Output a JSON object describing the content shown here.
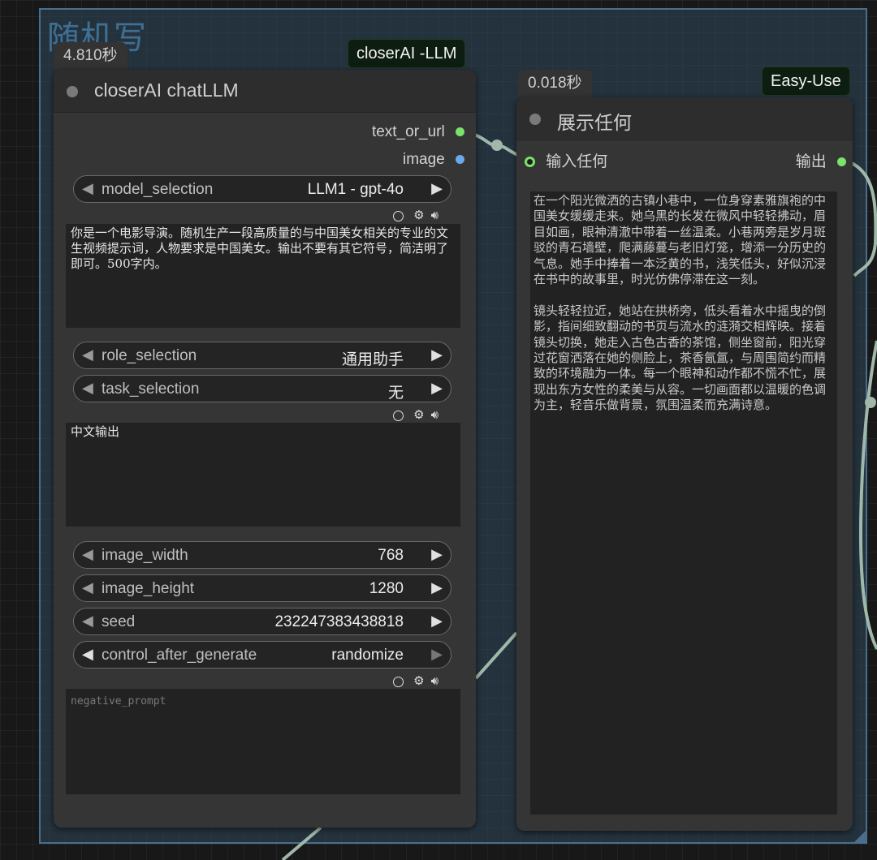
{
  "group": {
    "title": "随机写"
  },
  "node_llm": {
    "timing": "4.810秒",
    "badge": "closerAI -LLM",
    "title": "closerAI chatLLM",
    "outputs": [
      {
        "label": "text_or_url",
        "color": "#7be26b"
      },
      {
        "label": "image",
        "color": "#6aa9e8"
      }
    ],
    "model_selection": {
      "label": "model_selection",
      "value": "LLM1 - gpt-4o"
    },
    "prompt_text": "你是一个电影导演。随机生产一段高质量的与中国美女相关的专业的文生视频提示词，人物要求是中国美女。输出不要有其它符号，简洁明了即可。500字内。",
    "role_selection": {
      "label": "role_selection",
      "value": "通用助手"
    },
    "task_selection": {
      "label": "task_selection",
      "value": "无"
    },
    "task_text": "中文输出",
    "image_width": {
      "label": "image_width",
      "value": "768"
    },
    "image_height": {
      "label": "image_height",
      "value": "1280"
    },
    "seed": {
      "label": "seed",
      "value": "232247383438818"
    },
    "control_after_generate": {
      "label": "control_after_generate",
      "value": "randomize"
    },
    "negative_prompt": {
      "placeholder": "negative_prompt"
    }
  },
  "node_show": {
    "timing": "0.018秒",
    "badge": "Easy-Use",
    "title": "展示任何",
    "input_label": "输入任何",
    "output_label": "输出",
    "port_color": "#7be26b",
    "text": "在一个阳光微洒的古镇小巷中，一位身穿素雅旗袍的中国美女缓缓走来。她乌黑的长发在微风中轻轻拂动，眉目如画，眼神清澈中带着一丝温柔。小巷两旁是岁月斑驳的青石墙壁，爬满藤蔓与老旧灯笼，增添一分历史的气息。她手中捧着一本泛黄的书，浅笑低头，好似沉浸在书中的故事里，时光仿佛停滞在这一刻。\n\n镜头轻轻拉近，她站在拱桥旁，低头看着水中摇曳的倒影，指间细致翻动的书页与流水的涟漪交相辉映。接着镜头切换，她走入古色古香的茶馆，侧坐窗前，阳光穿过花窗洒落在她的侧脸上，茶香氤氲，与周围简约而精致的环境融为一体。每一个眼神和动作都不慌不忙，展现出东方女性的柔美与从容。一切画面都以温暖的色调为主，轻音乐做背景，氛围温柔而充满诗意。"
  }
}
